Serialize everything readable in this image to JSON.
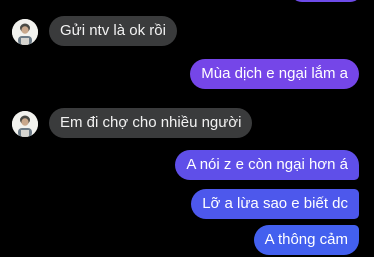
{
  "conversation": {
    "messages": [
      {
        "sender": "contact",
        "text": "Gửi ntv là ok rồi"
      },
      {
        "sender": "me",
        "text": "Mùa dịch e ngại lắm a"
      },
      {
        "sender": "contact",
        "text": "Em đi chợ cho nhiều người"
      },
      {
        "sender": "me",
        "text": "A nói z e còn ngại hơn á"
      },
      {
        "sender": "me",
        "text": "Lỡ a lừa sao e biết dc"
      },
      {
        "sender": "me",
        "text": "A thông cảm"
      }
    ]
  },
  "colors": {
    "background": "#000000",
    "received_bubble": "#3a3b3c",
    "sent_bubble_top": "#7546e8",
    "sent_bubble_bottom": "#4360ef"
  },
  "icons": {
    "contact_avatar": "contact-avatar-icon"
  }
}
